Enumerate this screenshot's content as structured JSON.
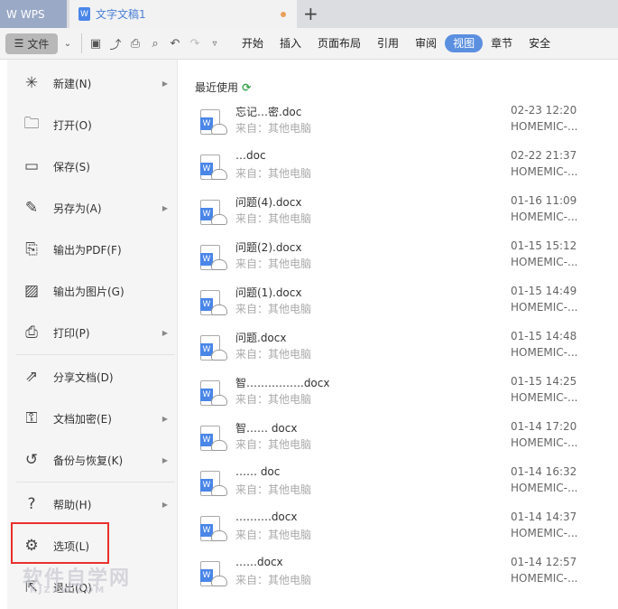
{
  "tabs": {
    "app": "WPS",
    "doc": "文字文稿1",
    "new_tab": "+"
  },
  "toolbar": {
    "file": "文件",
    "ribbon": [
      "开始",
      "插入",
      "页面布局",
      "引用",
      "审阅",
      "视图",
      "章节",
      "安全"
    ],
    "active": "视图"
  },
  "menu": [
    {
      "label": "新建(N)",
      "icon": "new-doc-icon",
      "sub": true
    },
    {
      "label": "打开(O)",
      "icon": "folder-icon",
      "sub": false
    },
    {
      "label": "保存(S)",
      "icon": "save-icon",
      "sub": false
    },
    {
      "label": "另存为(A)",
      "icon": "save-as-icon",
      "sub": true
    },
    {
      "label": "输出为PDF(F)",
      "icon": "pdf-icon",
      "sub": false
    },
    {
      "label": "输出为图片(G)",
      "icon": "image-icon",
      "sub": false
    },
    {
      "label": "打印(P)",
      "icon": "print-icon",
      "sub": true
    },
    {
      "label": "分享文档(D)",
      "icon": "share-icon",
      "sub": false
    },
    {
      "label": "文档加密(E)",
      "icon": "lock-doc-icon",
      "sub": true
    },
    {
      "label": "备份与恢复(K)",
      "icon": "backup-icon",
      "sub": true
    },
    {
      "label": "帮助(H)",
      "icon": "help-icon",
      "sub": true
    },
    {
      "label": "选项(L)",
      "icon": "gear-icon",
      "sub": false
    },
    {
      "label": "退出(Q)",
      "icon": "exit-icon",
      "sub": false
    }
  ],
  "recent_title": "最近使用",
  "files": [
    {
      "name": "忘记…密.doc",
      "src": "来自：其他电脑",
      "date": "02-23 12:20",
      "device": "HOMEMIC-..."
    },
    {
      "name": "…doc",
      "src": "来自：其他电脑",
      "date": "02-22 21:37",
      "device": "HOMEMIC-..."
    },
    {
      "name": "问题(4).docx",
      "src": "来自：其他电脑",
      "date": "01-16 11:09",
      "device": "HOMEMIC-..."
    },
    {
      "name": "问题(2).docx",
      "src": "来自：其他电脑",
      "date": "01-15 15:12",
      "device": "HOMEMIC-..."
    },
    {
      "name": "问题(1).docx",
      "src": "来自：其他电脑",
      "date": "01-15 14:49",
      "device": "HOMEMIC-..."
    },
    {
      "name": "问题.docx",
      "src": "来自：其他电脑",
      "date": "01-15 14:48",
      "device": "HOMEMIC-..."
    },
    {
      "name": "智…………….docx",
      "src": "来自：其他电脑",
      "date": "01-15 14:25",
      "device": "HOMEMIC-..."
    },
    {
      "name": "智…… docx",
      "src": "来自：其他电脑",
      "date": "01-14 17:20",
      "device": "HOMEMIC-..."
    },
    {
      "name": "…… doc",
      "src": "来自：其他电脑",
      "date": "01-14 16:32",
      "device": "HOMEMIC-..."
    },
    {
      "name": "……….docx",
      "src": "来自：其他电脑",
      "date": "01-14 14:37",
      "device": "HOMEMIC-..."
    },
    {
      "name": "……docx",
      "src": "来自：其他电脑",
      "date": "01-14 12:57",
      "device": "HOMEMIC-..."
    }
  ],
  "watermark": {
    "title": "软件自学网",
    "url": "RJZXW.COM"
  }
}
